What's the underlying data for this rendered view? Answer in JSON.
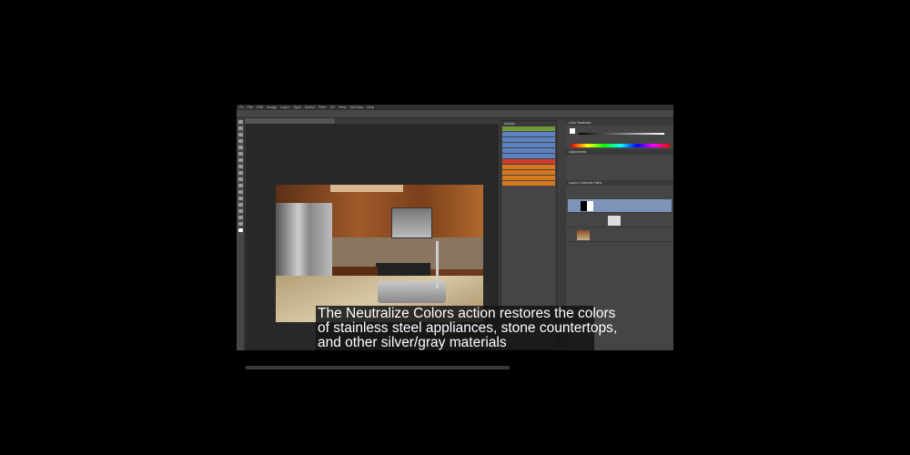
{
  "menu": [
    "Ps",
    "File",
    "Edit",
    "Image",
    "Layer",
    "Type",
    "Select",
    "Filter",
    "3D",
    "View",
    "Window",
    "Help"
  ],
  "panels": {
    "actions": "Actions",
    "color": "Color  Swatches",
    "adjustments": "Adjustments",
    "layers": "Layers  Channels  Paths"
  },
  "action_colors": [
    "#6f9a3c",
    "#5c80c0",
    "#5c80c0",
    "#5c80c0",
    "#5c80c0",
    "#5c80c0",
    "#d23a2a",
    "#d6791e",
    "#d6791e",
    "#d6791e",
    "#d6791e"
  ],
  "subtitle": {
    "line1": "The Neutralize Colors action restores the colors",
    "line2": "of stainless steel appliances, stone countertops,",
    "line3": "and other silver/gray materials"
  }
}
